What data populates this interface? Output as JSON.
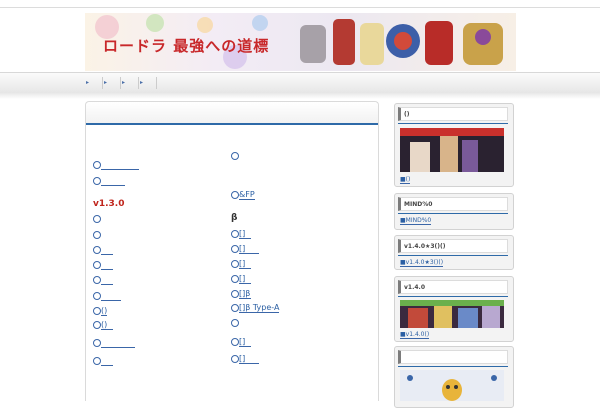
{
  "header": {
    "banner_title": "ロードラ 最強への道標"
  },
  "nav": {
    "items": [
      "▸",
      "▸",
      "▸",
      "▸"
    ]
  },
  "main": {
    "version_heading": "v1.3.0",
    "beta_heading": "β",
    "left_links": [
      {
        "text": "",
        "underline": 38
      },
      {
        "text": "",
        "underline": 24
      },
      {
        "text": "",
        "underline": 0
      },
      {
        "text": "",
        "underline": 0
      },
      {
        "text": "",
        "underline": 12
      },
      {
        "text": "",
        "underline": 12
      },
      {
        "text": "",
        "underline": 12
      },
      {
        "text": "",
        "underline": 20
      },
      {
        "text": "()",
        "underline": 6
      },
      {
        "text": "()",
        "underline": 12
      },
      {
        "text": "",
        "underline": 34
      },
      {
        "text": "",
        "underline": 12
      }
    ],
    "right_links": [
      {
        "text": "",
        "underline": 0
      },
      {
        "text": "&FP",
        "underline": 12
      },
      {
        "text": "[]",
        "underline": 12
      },
      {
        "text": "[]",
        "underline": 20
      },
      {
        "text": "[]",
        "underline": 12
      },
      {
        "text": "[]",
        "underline": 12
      },
      {
        "text": "[]β",
        "underline": 12
      },
      {
        "text": "[]β Type-A",
        "underline": 10
      },
      {
        "text": "",
        "underline": 0
      },
      {
        "text": "[]",
        "underline": 12
      },
      {
        "text": "[]",
        "underline": 20
      }
    ]
  },
  "sidebar": {
    "widgets": [
      {
        "title": "()",
        "link": "■()"
      },
      {
        "title": "MIND%0",
        "link": "■MIND%0"
      },
      {
        "title": "v1.4.0★3()()",
        "link": "■v1.4.0★3()()"
      },
      {
        "title": "v1.4.0",
        "link": "■v1.4.0()"
      },
      {
        "title": "",
        "link": ""
      }
    ]
  },
  "colors": {
    "link": "#2b5fa3",
    "version": "#c0251c",
    "accent_line": "#2e6aa8"
  }
}
